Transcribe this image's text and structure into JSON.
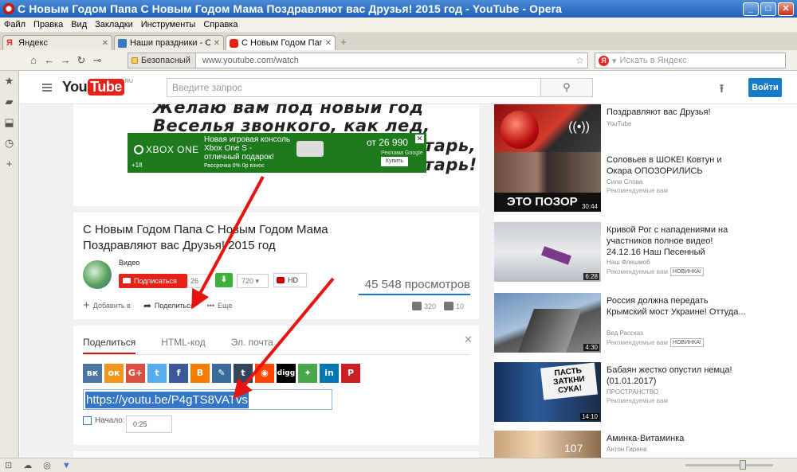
{
  "window": {
    "title": "С Новым Годом Папа С Новым Годом Мама Поздравляют вас Друзья! 2015 год - YouTube - Opera",
    "min": "_",
    "max": "□",
    "close": "✕"
  },
  "menu": [
    "Файл",
    "Правка",
    "Вид",
    "Закладки",
    "Инструменты",
    "Справка"
  ],
  "tabs": [
    {
      "label": "Яндекс",
      "close": "✕"
    },
    {
      "label": "Наши праздники - С...",
      "close": "✕"
    },
    {
      "label": "С Новым Годом Пап...",
      "close": "✕"
    }
  ],
  "newtab": "+",
  "addressbar": {
    "secure_label": "Безопасный",
    "url": "www.youtube.com/watch",
    "search_placeholder": "Искать в Яндекс",
    "yandex_letter": "Я"
  },
  "youtube": {
    "logo_you": "You",
    "logo_tube": "Tube",
    "logo_region": "RU",
    "search_placeholder": "Введите запрос",
    "signin": "Войти"
  },
  "player": {
    "poem_lines": [
      "Желаю вам под новый год",
      "Веселья звонкого, как лед,",
      "тарь,",
      "тарь!"
    ],
    "ad": {
      "brand": "XBOX ONE",
      "age": "+18",
      "offer_line1": "Новая игровая консоль",
      "offer_line2": "Xbox One S -",
      "offer_line3": "отличный подарок!",
      "offer_small": "Рассрочка 0% 0р взнос",
      "price": "от 26 990",
      "buy": "Купить",
      "advertiser": "Реклама Google",
      "close": "✕"
    }
  },
  "video": {
    "title": "С Новым Годом Папа С Новым Годом Мама Поздравляют вас Друзья! 2015 год",
    "channel": "Видео",
    "subscribe": "Подписаться",
    "sub_count": "26",
    "quality": "720",
    "hd": "HD",
    "views": "45 548 просмотров",
    "actions": {
      "add": "Добавить в",
      "share": "Поделиться",
      "more": "Еще"
    },
    "likes": "320",
    "dislikes": "10"
  },
  "share": {
    "tabs": [
      "Поделиться",
      "HTML-код",
      "Эл. почта"
    ],
    "close": "✕",
    "networks": [
      {
        "name": "vk",
        "glyph": "вк",
        "color": "#4c75a3"
      },
      {
        "name": "odnoklassniki",
        "glyph": "ок",
        "color": "#f2961f"
      },
      {
        "name": "google-plus",
        "glyph": "G+",
        "color": "#dc4e41"
      },
      {
        "name": "twitter",
        "glyph": "t",
        "color": "#55acee"
      },
      {
        "name": "facebook",
        "glyph": "f",
        "color": "#3b5998"
      },
      {
        "name": "blogger",
        "glyph": "B",
        "color": "#f57d00"
      },
      {
        "name": "livejournal",
        "glyph": "✎",
        "color": "#3b6c9a"
      },
      {
        "name": "tumblr",
        "glyph": "t",
        "color": "#35465c"
      },
      {
        "name": "reddit",
        "glyph": "◉",
        "color": "#ff4500"
      },
      {
        "name": "digg",
        "glyph": "digg",
        "color": "#000000"
      },
      {
        "name": "stumbleupon",
        "glyph": "✦",
        "color": "#4ca64c"
      },
      {
        "name": "linkedin",
        "glyph": "in",
        "color": "#0077b5"
      },
      {
        "name": "pinterest",
        "glyph": "P",
        "color": "#cb2027"
      }
    ],
    "link": "https://youtu.be/P4gTS8VATvs",
    "start_label": "Начало:",
    "start_time": "0:25"
  },
  "recommendations": [
    {
      "title": "Поздравляют вас Друзья!",
      "channel": "YouTube",
      "meta": "",
      "badge": "",
      "duration": ""
    },
    {
      "title": "Соловьев в ШОКЕ! Ковтун и Окара ОПОЗОРИЛИСЬ",
      "channel": "Сила Слова",
      "meta": "Рекомендуемые вам",
      "badge": "",
      "duration": "30:44",
      "thumb_text": "ЭТО ПОЗОР"
    },
    {
      "title": "Кривой Рог с нападениями на участников полное видео! 24.12.16 Наш Песенный",
      "channel": "Наш Флешмоб",
      "meta": "Рекомендуемые вам",
      "badge": "НОВИНКА!",
      "duration": "6:28"
    },
    {
      "title": "Россия должна передать Крымский мост Украине! Оттуда...",
      "channel": "Вед Рассказ",
      "meta": "Рекомендуемые вам",
      "badge": "НОВИНКА!",
      "duration": "4:30"
    },
    {
      "title": "Бабаян жестко опустил немца! (01.01.2017)",
      "channel": "ПРОСТРАНСТВО",
      "meta": "Рекомендуемые вам",
      "badge": "",
      "duration": "14:10",
      "thumb_text": "ПАСТЬ ЗАТКНИ СУКА!"
    },
    {
      "title": "Аминка-Витаминка",
      "channel": "Антон Гиреев",
      "meta": "",
      "badge": "",
      "duration": "",
      "thumb_text": "107"
    }
  ]
}
